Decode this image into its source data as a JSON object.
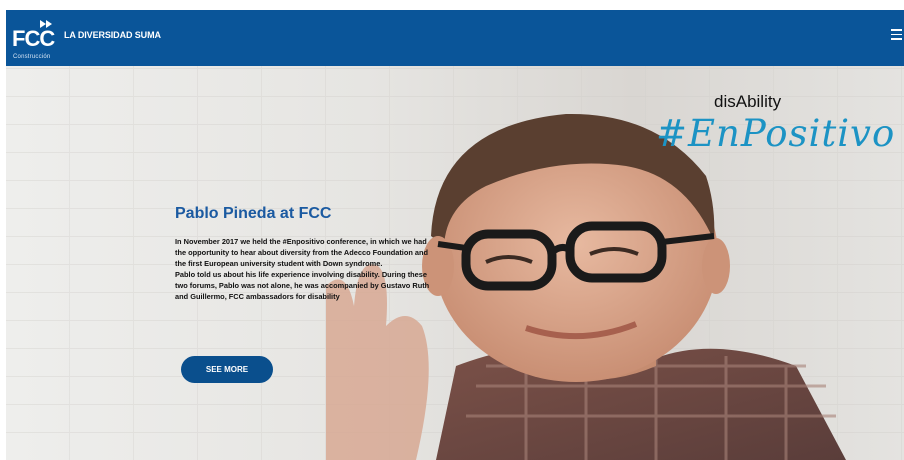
{
  "header": {
    "logo_text": "FCC",
    "logo_subtext": "Construcción",
    "title": "LA DIVERSIDAD SUMA",
    "menu_icon": "hamburger-menu-icon"
  },
  "hero": {
    "tagline_small": "disAbility",
    "tagline_big": "#EnPositivo",
    "title": "Pablo Pineda at FCC",
    "paragraph_1": "In November 2017 we held the #Enpositivo conference, in which we had the opportunity to hear about diversity from the Adecco Foundation and the first European university student with Down syndrome.",
    "paragraph_2": "Pablo told us about his life experience involving disability. During these two forums, Pablo was not alone, he was accompanied by Gustavo Ruth and Guillermo, FCC ambassadors for disability",
    "button_label": "SEE MORE"
  },
  "colors": {
    "header_bg": "#0a5599",
    "title": "#1b5aa1",
    "tagline_accent": "#1c93c4",
    "button_bg": "#0a4f8d"
  }
}
